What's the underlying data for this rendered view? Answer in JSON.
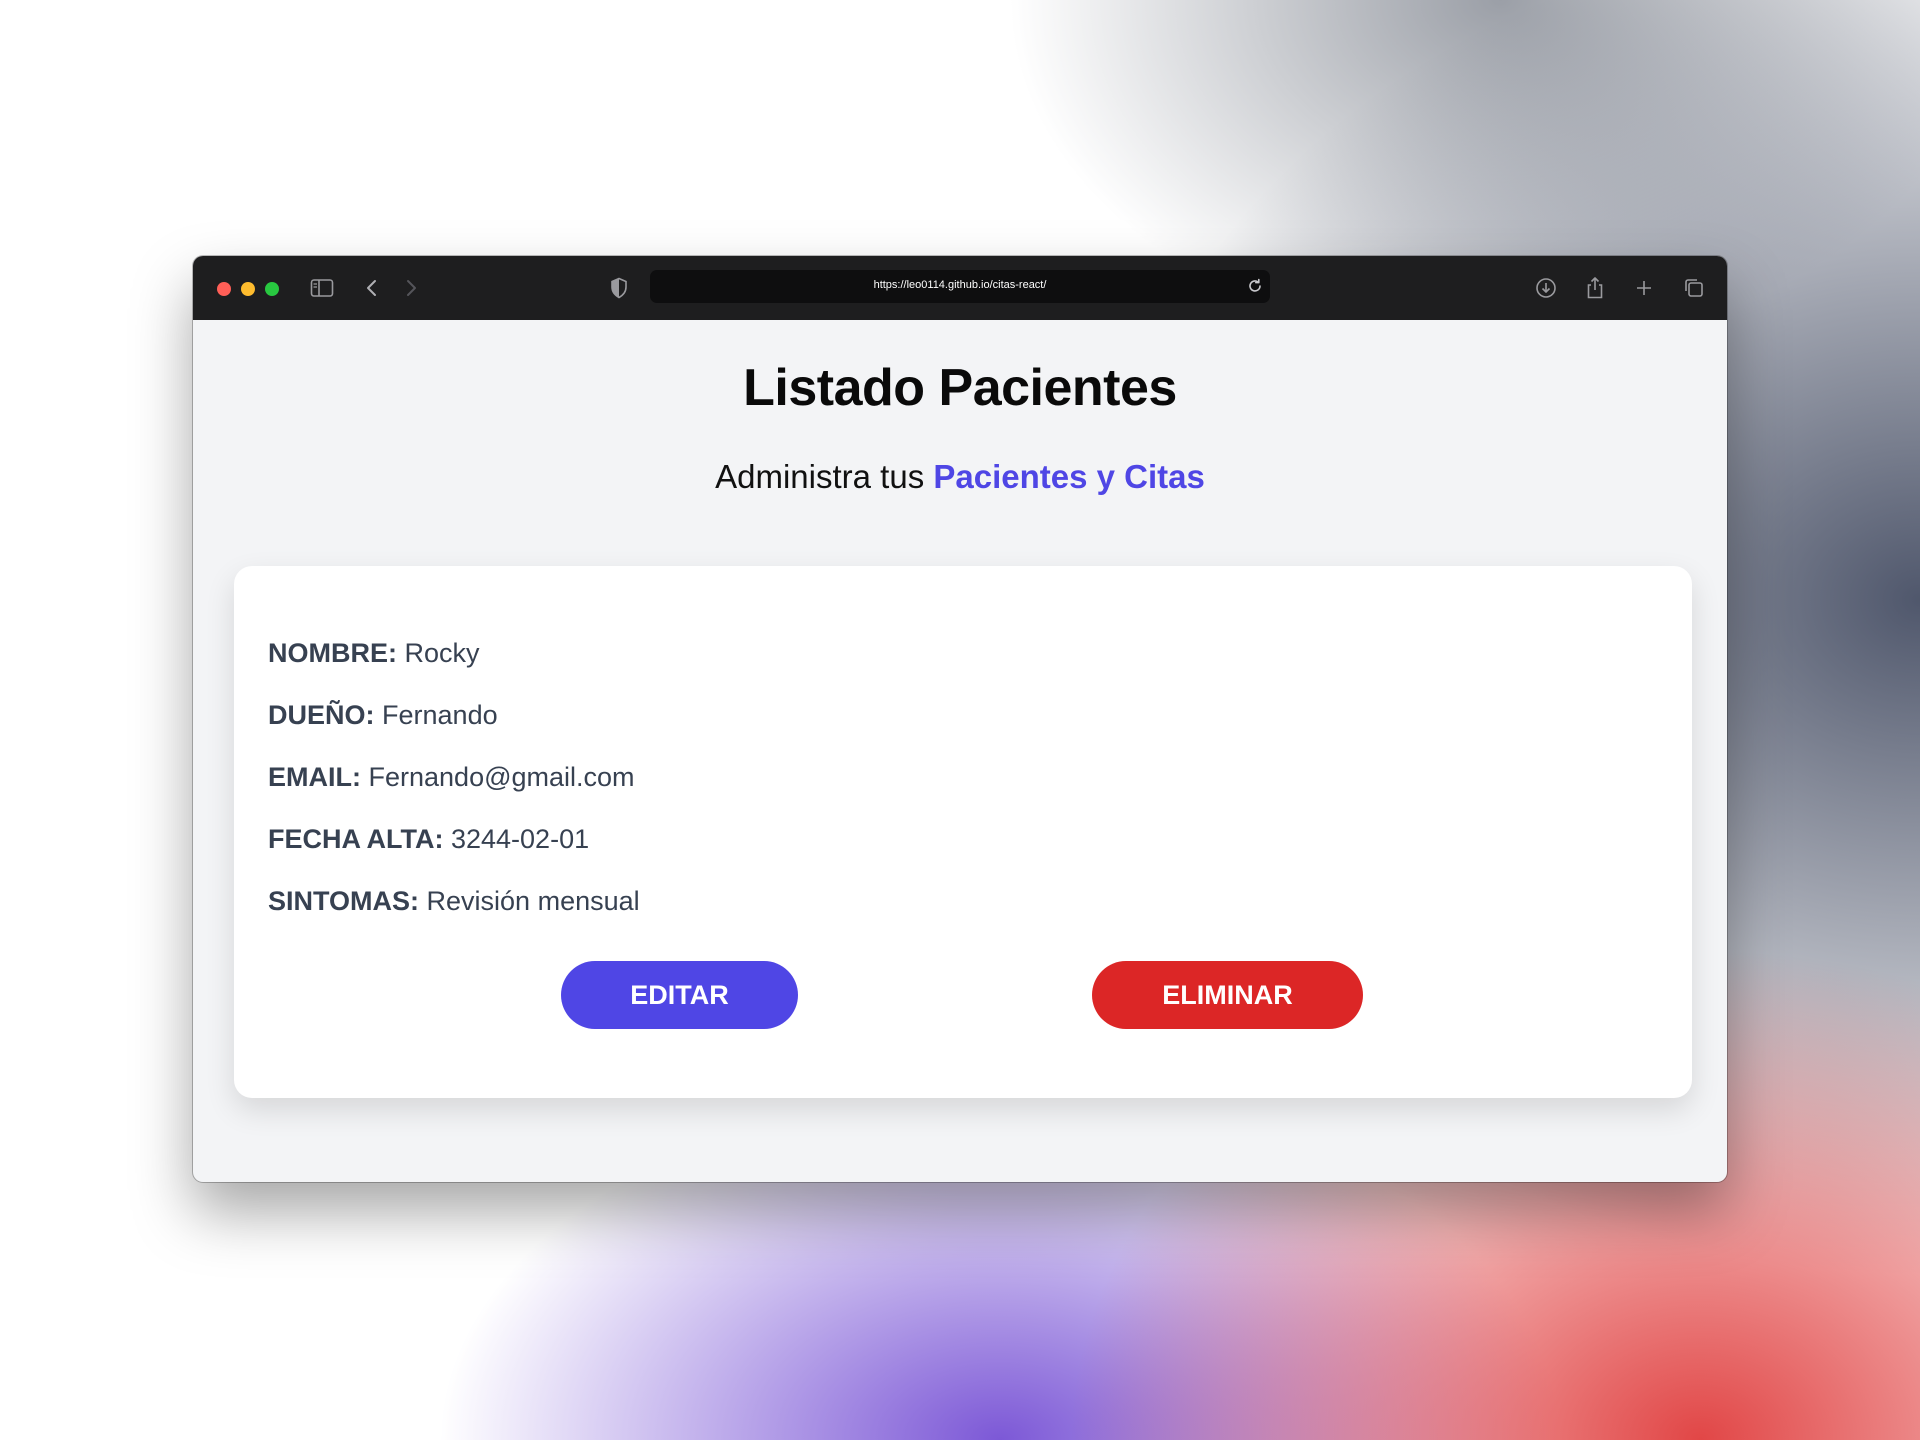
{
  "browser": {
    "url": "https://leo0114.github.io/citas-react/",
    "traffic_colors": {
      "close": "#ff5f57",
      "minimize": "#febc2e",
      "zoom": "#28c840"
    }
  },
  "page": {
    "title": "Listado Pacientes",
    "subtitle_prefix": "Administra tus",
    "subtitle_highlight": "Pacientes y Citas"
  },
  "patient": {
    "name_label": "NOMBRE:",
    "name": "Rocky",
    "owner_label": "DUEÑO:",
    "owner": "Fernando",
    "email_label": "EMAIL:",
    "email": "Fernando@gmail.com",
    "date_label": "FECHA ALTA:",
    "date": "3244-02-01",
    "symptoms_label": "SINTOMAS:",
    "symptoms": "Revisión mensual"
  },
  "actions": {
    "edit_label": "EDITAR",
    "delete_label": "ELIMINAR"
  },
  "colors": {
    "accent": "#4f46e5",
    "danger": "#dc2626"
  },
  "icons": [
    "sidebar-icon",
    "back-icon",
    "forward-icon",
    "shield-icon",
    "reload-icon",
    "download-icon",
    "share-icon",
    "new-tab-icon",
    "tabs-overview-icon"
  ]
}
